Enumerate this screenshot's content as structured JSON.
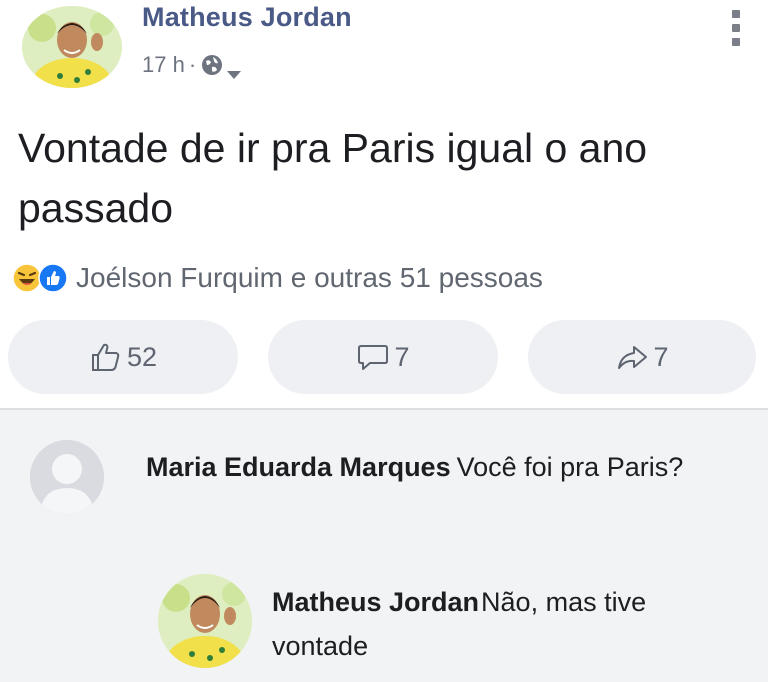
{
  "post": {
    "author": "Matheus Jordan",
    "time": "17 h",
    "separator": "·",
    "privacy_icon": "globe-icon",
    "menu_icon": "vertical-dots-icon",
    "text": "Vontade de ir pra Paris igual o ano passado",
    "reactions": {
      "icons": [
        "laugh-reaction-icon",
        "like-reaction-icon"
      ],
      "summary": "Joélson Furquim e outras 51 pessoas"
    },
    "actions": {
      "like_count": "52",
      "comment_count": "7",
      "share_count": "7"
    }
  },
  "comments": [
    {
      "author": "Maria Eduarda Marques",
      "text": "Você foi pra Paris?",
      "avatar_icon": "default-profile-icon"
    },
    {
      "author": "Matheus Jordan",
      "text": "Não, mas tive vontade",
      "avatar_icon": "profile-photo"
    }
  ],
  "colors": {
    "author_link": "#4a5a86",
    "text": "#1c1e21",
    "meta": "#6e7380",
    "button_bg": "#eef0f3",
    "comment_area_bg": "#f2f3f5"
  }
}
